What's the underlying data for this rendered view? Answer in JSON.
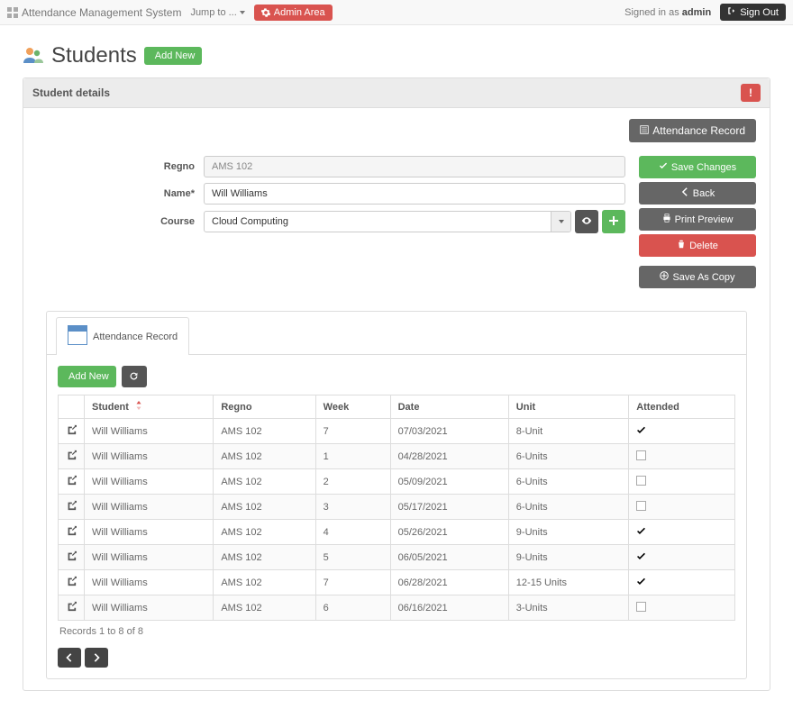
{
  "navbar": {
    "brand": "Attendance Management System",
    "jump_to": "Jump to ...",
    "admin_area": "Admin Area",
    "signed_in_as": "Signed in as",
    "username": "admin",
    "sign_out": "Sign Out"
  },
  "page": {
    "title": "Students",
    "add_new": "Add New"
  },
  "panel": {
    "heading": "Student details",
    "alert_label": "!",
    "attendance_record_btn": "Attendance Record",
    "actions": {
      "save": "Save Changes",
      "back": "Back",
      "print": "Print Preview",
      "delete": "Delete",
      "save_copy": "Save As Copy"
    },
    "form": {
      "regno_label": "Regno",
      "regno_value": "AMS 102",
      "name_label": "Name*",
      "name_value": "Will Williams",
      "course_label": "Course",
      "course_value": "Cloud Computing"
    }
  },
  "child": {
    "tab_label": "Attendance Record",
    "add_new": "Add New",
    "columns": [
      "Student",
      "Regno",
      "Week",
      "Date",
      "Unit",
      "Attended"
    ],
    "rows": [
      {
        "student": "Will Williams",
        "regno": "AMS 102",
        "week": "7",
        "date": "07/03/2021",
        "unit": "8-Unit",
        "attended": true
      },
      {
        "student": "Will Williams",
        "regno": "AMS 102",
        "week": "1",
        "date": "04/28/2021",
        "unit": "6-Units",
        "attended": false
      },
      {
        "student": "Will Williams",
        "regno": "AMS 102",
        "week": "2",
        "date": "05/09/2021",
        "unit": "6-Units",
        "attended": false
      },
      {
        "student": "Will Williams",
        "regno": "AMS 102",
        "week": "3",
        "date": "05/17/2021",
        "unit": "6-Units",
        "attended": false
      },
      {
        "student": "Will Williams",
        "regno": "AMS 102",
        "week": "4",
        "date": "05/26/2021",
        "unit": "9-Units",
        "attended": true
      },
      {
        "student": "Will Williams",
        "regno": "AMS 102",
        "week": "5",
        "date": "06/05/2021",
        "unit": "9-Units",
        "attended": true
      },
      {
        "student": "Will Williams",
        "regno": "AMS 102",
        "week": "7",
        "date": "06/28/2021",
        "unit": "12-15 Units",
        "attended": true
      },
      {
        "student": "Will Williams",
        "regno": "AMS 102",
        "week": "6",
        "date": "06/16/2021",
        "unit": "3-Units",
        "attended": false
      }
    ],
    "footer": "Records 1 to 8 of 8"
  },
  "colors": {
    "green": "#5cb85c",
    "red": "#d9534f",
    "dark": "#333"
  }
}
